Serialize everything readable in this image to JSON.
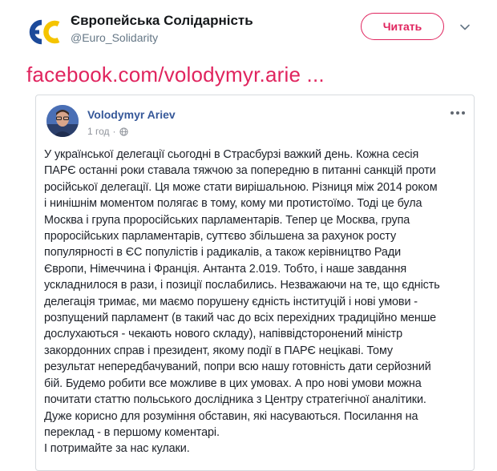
{
  "tweet": {
    "author_name": "Європейська Солідарність",
    "author_handle": "@Euro_Solidarity",
    "follow_label": "Читать",
    "logo_text": "ЄС",
    "link_text": "facebook.com/volodymyr.arie ...",
    "colors": {
      "accent": "#e0245e",
      "logo_blue": "#1c4a9a",
      "logo_yellow": "#f5c400"
    }
  },
  "fb_post": {
    "author": "Volodymyr Ariev",
    "time": "1 год",
    "lines": [
      "У української делегації сьогодні в Страсбурзі важкий день. Кожна сесія",
      "ПАРЄ останні роки ставала тяжчою за попередню в питанні санкцій проти",
      "російської делегації. Ця може стати вирішальною. Різниця між 2014 роком",
      "і нинішнім моментом полягає в тому, кому ми протистоїмо. Тоді це була",
      "Москва і група проросійських парламентарів. Тепер це Москва, група",
      "проросійських парламентарів, суттєво збільшена за рахунок росту",
      "популярності в ЄС популістів і радикалів, а також керівництво Ради",
      "Європи, Німеччина і Франція. Антанта 2.019. Тобто, і наше завдання",
      "ускладнилося в рази, і позиції послабились. Незважаючи на те, що єдність",
      "делегація тримає, ми маємо порушену єдність інституцій і нові умови -",
      "розпущений парламент (в такий час до всіх перехідних традиційно менше",
      "дослухаються - чекають нового складу), напіввідсторонений міністр",
      "закордонних справ і президент, якому події в ПАРЄ нецікаві. Тому",
      "результат непередбачуваний, попри всю нашу готовність дати серйозний",
      "бій. Будемо робити все можливе в цих умовах. А про нові умови можна",
      "почитати статтю польського дослідника з Центру стратегічної аналітики.",
      "Дуже корисно для розуміння обставин, які насуваються. Посилання на",
      "переклад - в першому коментарі.",
      "І потримайте за нас кулаки."
    ]
  }
}
